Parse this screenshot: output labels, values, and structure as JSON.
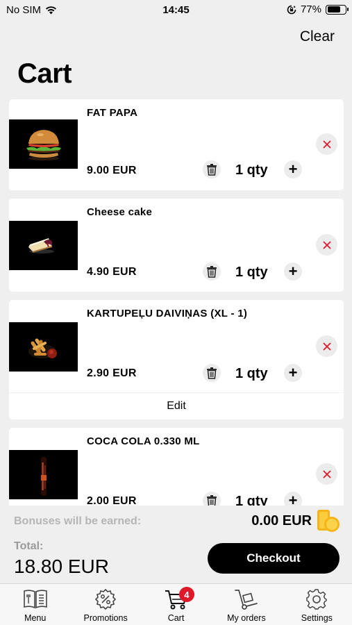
{
  "status_bar": {
    "carrier": "No SIM",
    "time": "14:45",
    "battery": "77%",
    "battery_level": 0.77
  },
  "header": {
    "clear_label": "Clear",
    "title": "Cart"
  },
  "cart": {
    "items": [
      {
        "name": "FAT PAPA",
        "price": "9.00 EUR",
        "qty": "1 qty",
        "thumb": "burger-photo"
      },
      {
        "name": "Cheese cake",
        "price": "4.90 EUR",
        "qty": "1 qty",
        "thumb": "cheesecake-photo"
      },
      {
        "name": "KARTUPEĻU DAIVIŅAS (XL - 1)",
        "price": "2.90 EUR",
        "qty": "1 qty",
        "thumb": "fries-photo",
        "edit_label": "Edit"
      },
      {
        "name": "COCA COLA 0.330 ML",
        "price": "2.00 EUR",
        "qty": "1 qty",
        "thumb": "cola-bottle-photo"
      }
    ]
  },
  "summary": {
    "bonus_label": "Bonuses will be earned:",
    "bonus_value": "0.00 EUR",
    "total_label": "Total:",
    "total_value": "18.80 EUR",
    "checkout_label": "Checkout"
  },
  "tabbar": {
    "tabs": [
      {
        "label": "Menu",
        "icon": "menu-book-icon"
      },
      {
        "label": "Promotions",
        "icon": "percent-badge-icon"
      },
      {
        "label": "Cart",
        "icon": "cart-icon",
        "badge": "4",
        "active": true
      },
      {
        "label": "My orders",
        "icon": "hand-truck-icon"
      },
      {
        "label": "Settings",
        "icon": "gear-icon"
      }
    ]
  },
  "colors": {
    "background": "#efefef",
    "card": "#ffffff",
    "remove_x": "#e0192a",
    "badge": "#e0192a",
    "checkout_bg": "#000000",
    "muted_text": "#b5b5b5"
  }
}
